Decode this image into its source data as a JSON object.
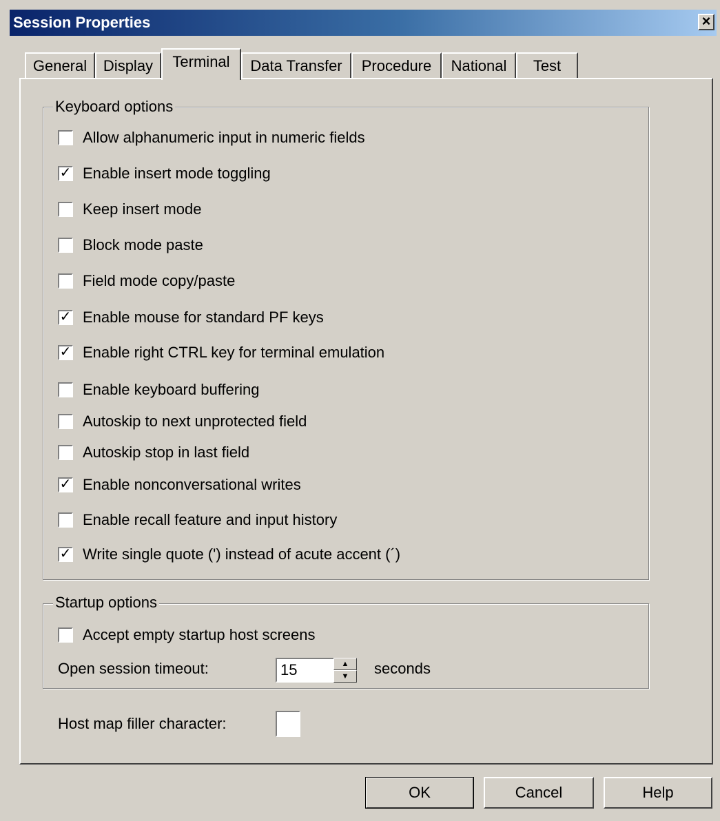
{
  "window": {
    "title": "Session Properties",
    "close_icon": "close-icon"
  },
  "tabs": [
    {
      "label": "General",
      "active": false
    },
    {
      "label": "Display",
      "active": false
    },
    {
      "label": "Terminal",
      "active": true
    },
    {
      "label": "Data Transfer",
      "active": false
    },
    {
      "label": "Procedure",
      "active": false
    },
    {
      "label": "National",
      "active": false
    },
    {
      "label": "Test",
      "active": false
    }
  ],
  "keyboard": {
    "legend": "Keyboard options",
    "options": [
      {
        "label": "Allow alphanumeric input in numeric fields",
        "checked": false
      },
      {
        "label": "Enable insert mode toggling",
        "checked": true
      },
      {
        "label": "Keep insert mode",
        "checked": false
      },
      {
        "label": "Block mode paste",
        "checked": false
      },
      {
        "label": "Field mode copy/paste",
        "checked": false
      },
      {
        "label": "Enable mouse for standard PF keys",
        "checked": true
      },
      {
        "label": "Enable right CTRL key for terminal emulation",
        "checked": true
      },
      {
        "label": "Enable keyboard buffering",
        "checked": false
      },
      {
        "label": "Autoskip to next unprotected field",
        "checked": false
      },
      {
        "label": "Autoskip stop in last field",
        "checked": false
      },
      {
        "label": "Enable nonconversational writes",
        "checked": true
      },
      {
        "label": "Enable recall feature and input history",
        "checked": false
      },
      {
        "label": "Write single quote (') instead of acute accent (´)",
        "checked": true
      }
    ]
  },
  "startup": {
    "legend": "Startup options",
    "accept_empty": {
      "label": "Accept empty startup host screens",
      "checked": false
    },
    "timeout_label": "Open session timeout:",
    "timeout_value": "15",
    "timeout_unit": "seconds"
  },
  "filler": {
    "label": "Host map filler character:",
    "value": ""
  },
  "buttons": {
    "ok": "OK",
    "cancel": "Cancel",
    "help": "Help"
  }
}
